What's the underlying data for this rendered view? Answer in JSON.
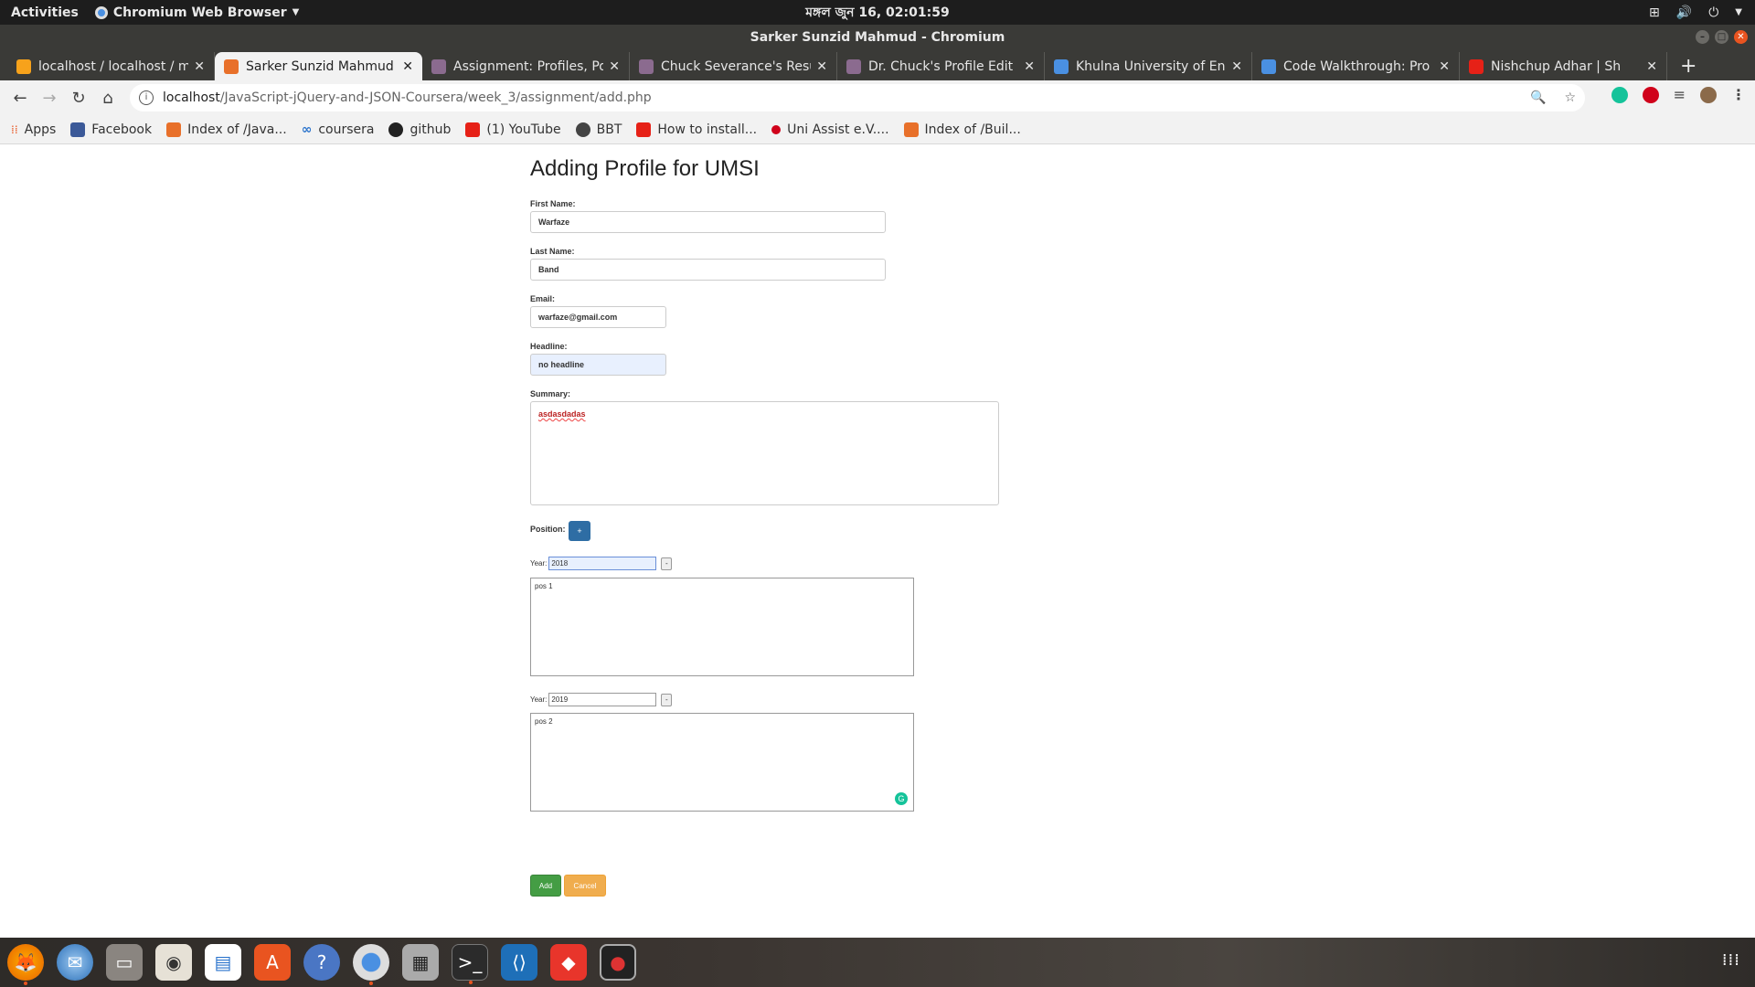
{
  "topbar": {
    "activities": "Activities",
    "app_name": "Chromium Web Browser",
    "clock": "মঙ্গল জুন 16, 02:01:59"
  },
  "window": {
    "title": "Sarker Sunzid Mahmud - Chromium"
  },
  "tabs": [
    {
      "title": "localhost / localhost / m",
      "color": "#f7a21b"
    },
    {
      "title": "Sarker Sunzid Mahmud",
      "color": "#e8702a"
    },
    {
      "title": "Assignment: Profiles, Po",
      "color": "#8b6b8f"
    },
    {
      "title": "Chuck Severance's Resu",
      "color": "#8b6b8f"
    },
    {
      "title": "Dr. Chuck's Profile Edit",
      "color": "#8b6b8f"
    },
    {
      "title": "Khulna University of Eng",
      "color": "#4a90e2"
    },
    {
      "title": "Code Walkthrough: Pro",
      "color": "#4a90e2"
    },
    {
      "title": "Nishchup Adhar | Sh",
      "color": "#e62117"
    }
  ],
  "omnibox": {
    "host": "localhost",
    "path": "/JavaScript-jQuery-and-JSON-Coursera/week_3/assignment/add.php"
  },
  "bookmarks": [
    {
      "label": "Apps",
      "color": "#e95420"
    },
    {
      "label": "Facebook",
      "color": "#3b5998"
    },
    {
      "label": "Index of /Java...",
      "color": "#e8702a"
    },
    {
      "label": "coursera",
      "color": "#2a73cc"
    },
    {
      "label": "github",
      "color": "#222222"
    },
    {
      "label": "(1) YouTube",
      "color": "#e62117"
    },
    {
      "label": "BBT",
      "color": "#444444"
    },
    {
      "label": "How to install...",
      "color": "#e62117"
    },
    {
      "label": "Uni Assist e.V....",
      "color": "#d0021b"
    },
    {
      "label": "Index of /Buil...",
      "color": "#e8702a"
    }
  ],
  "form": {
    "heading": "Adding Profile for UMSI",
    "first_name_label": "First Name:",
    "first_name_value": "Warfaze",
    "last_name_label": "Last Name:",
    "last_name_value": "Band",
    "email_label": "Email:",
    "email_value": "warfaze@gmail.com",
    "headline_label": "Headline:",
    "headline_value": "no headline",
    "summary_label": "Summary:",
    "summary_value": "asdasdadas",
    "position_label": "Position:",
    "plus_label": "+",
    "positions": [
      {
        "year_label": "Year:",
        "year": "2018",
        "minus": "-",
        "desc": "pos 1"
      },
      {
        "year_label": "Year:",
        "year": "2019",
        "minus": "-",
        "desc": "pos 2"
      }
    ],
    "add_label": "Add",
    "cancel_label": "Cancel"
  },
  "dock": [
    "firefox-icon",
    "thunderbird-icon",
    "files-icon",
    "rhythmbox-icon",
    "libreoffice-writer-icon",
    "software-center-icon",
    "help-icon",
    "chromium-icon",
    "screenshot-icon",
    "terminal-icon",
    "vscode-icon",
    "git-icon",
    "recorder-icon"
  ]
}
